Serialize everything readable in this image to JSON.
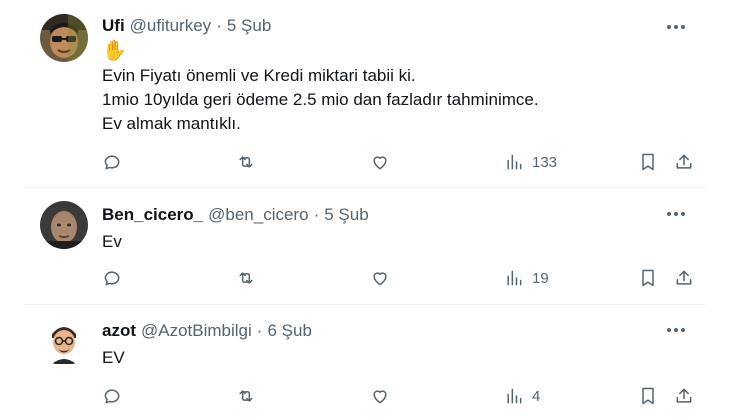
{
  "tweets": [
    {
      "name": "Ufi",
      "handle": "@ufiturkey",
      "separator": "·",
      "date": "5 Şub",
      "lines": [
        "✋",
        "Evin Fiyatı önemli ve Kredi miktari tabii ki.",
        "1mio 10yılda geri ödeme 2.5 mio dan fazladır tahminimce.",
        "Ev almak mantıklı."
      ],
      "views": "133"
    },
    {
      "name": "Ben_cicero_",
      "handle": "@ben_cicero",
      "separator": "·",
      "date": "5 Şub",
      "lines": [
        "Ev"
      ],
      "views": "19"
    },
    {
      "name": "azot",
      "handle": "@AzotBimbilgi",
      "separator": "·",
      "date": "6 Şub",
      "lines": [
        "EV"
      ],
      "views": "4"
    }
  ],
  "icons": {
    "reply": "reply-icon",
    "retweet": "retweet-icon",
    "like": "like-icon",
    "views": "views-icon",
    "bookmark": "bookmark-icon",
    "share": "share-icon",
    "more": "more-icon"
  }
}
